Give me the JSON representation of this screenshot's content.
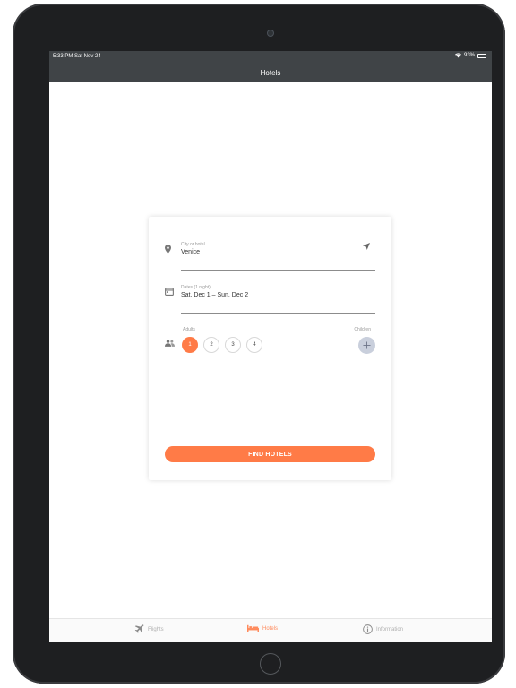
{
  "status_bar": {
    "time": "5:33 PM  Sat Nov 24",
    "battery": "93%"
  },
  "nav": {
    "title": "Hotels"
  },
  "search": {
    "city": {
      "label": "City or hotel",
      "value": "Venice"
    },
    "dates": {
      "label": "Dates (1 night)",
      "value": "Sat, Dec 1 – Sun, Dec 2"
    },
    "adults_label": "Adults",
    "children_label": "Children",
    "adult_options": [
      "1",
      "2",
      "3",
      "4"
    ],
    "selected_adults": "1",
    "find_button": "FIND HOTELS"
  },
  "tabs": [
    {
      "label": "Flights",
      "icon": "airplane-icon"
    },
    {
      "label": "Hotels",
      "icon": "bed-icon"
    },
    {
      "label": "Information",
      "icon": "info-icon"
    }
  ],
  "colors": {
    "accent": "#ff7b47",
    "topbar": "#404447",
    "add_child": "#c9cfdc"
  }
}
